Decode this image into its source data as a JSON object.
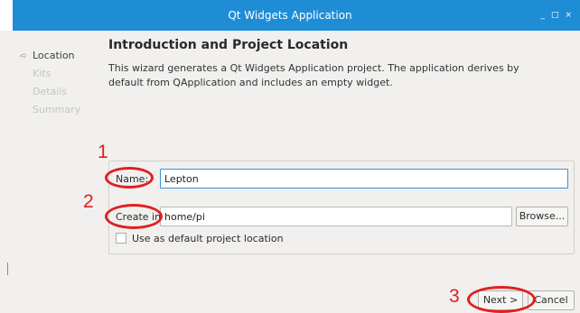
{
  "window": {
    "title": "Qt Widgets Application",
    "controls": [
      "_",
      "□",
      "×"
    ]
  },
  "steps": [
    {
      "label": "Location",
      "active": true
    },
    {
      "label": "Kits",
      "active": false
    },
    {
      "label": "Details",
      "active": false
    },
    {
      "label": "Summary",
      "active": false
    }
  ],
  "page": {
    "title": "Introduction and Project Location",
    "description": "This wizard generates a Qt Widgets Application project. The application derives by default from QApplication and includes an empty widget."
  },
  "form": {
    "name_label": "Name:",
    "name_value": "Lepton",
    "create_in_label": "Create in:",
    "create_in_value": "home/pi",
    "browse_label": "Browse...",
    "default_location_label": "Use as default project location",
    "default_location_checked": false
  },
  "footer": {
    "next_label": "Next >",
    "cancel_label": "Cancel"
  },
  "annotations": {
    "marker_1": "1",
    "marker_2": "2",
    "marker_3": "3",
    "color": "#e01f1f"
  },
  "icons": {
    "active_step": "arrow-right-icon"
  }
}
